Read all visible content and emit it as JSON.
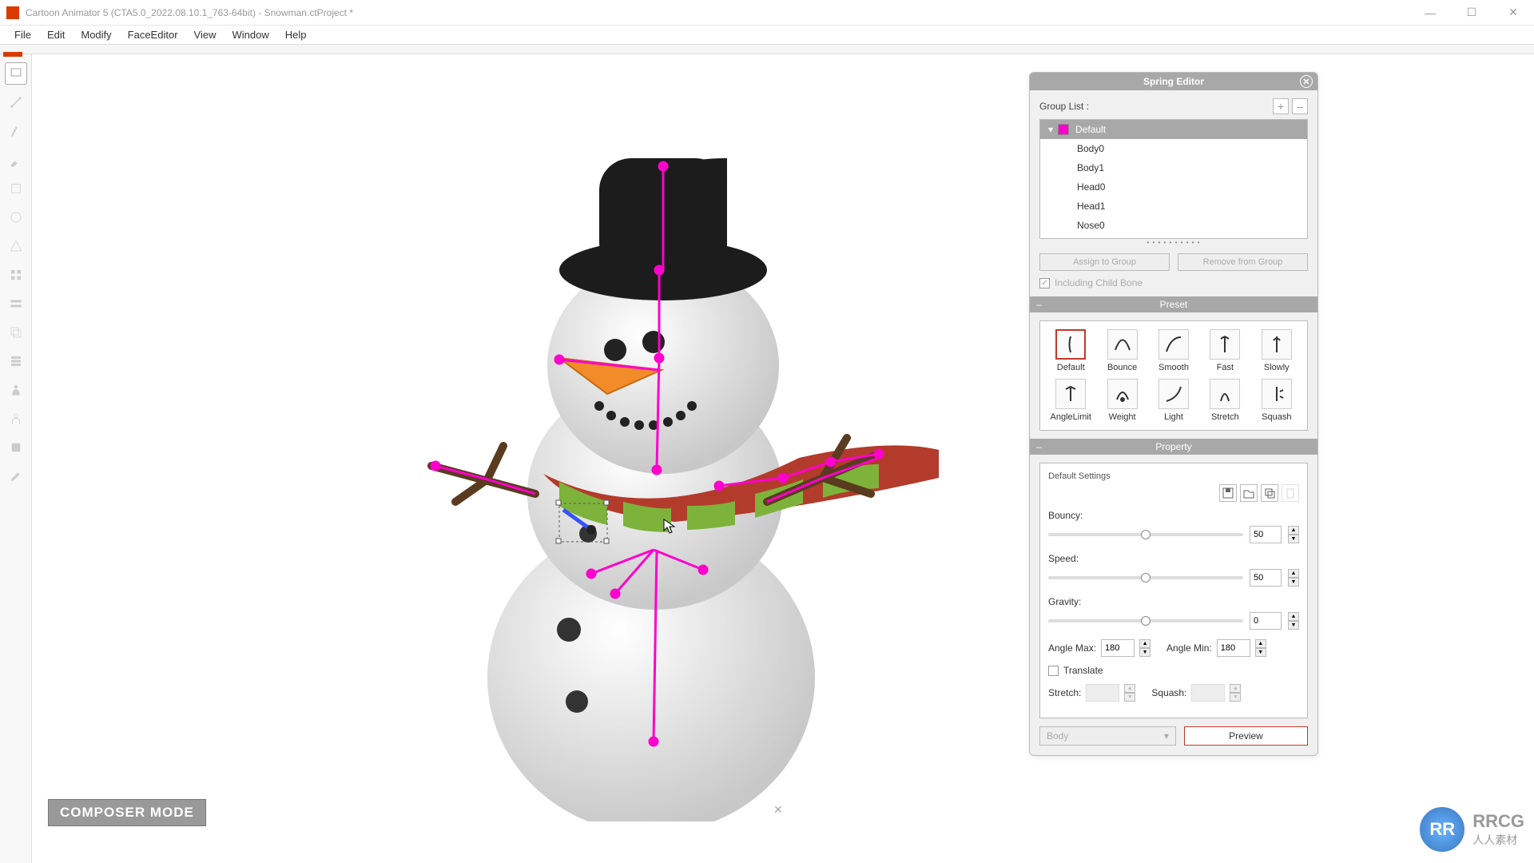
{
  "window": {
    "title": "Cartoon Animator 5 (CTA5.0_2022.08.10.1_763-64bit) - Snowman.ctProject *"
  },
  "menu": {
    "file": "File",
    "edit": "Edit",
    "modify": "Modify",
    "face_editor": "FaceEditor",
    "view": "View",
    "window": "Window",
    "help": "Help"
  },
  "mode_badge": "COMPOSER MODE",
  "spring_editor": {
    "title": "Spring Editor",
    "group_list_label": "Group List :",
    "add": "+",
    "remove": "–",
    "groups": {
      "default": "Default",
      "body0": "Body0",
      "body1": "Body1",
      "head0": "Head0",
      "head1": "Head1",
      "nose0": "Nose0"
    },
    "assign": "Assign to Group",
    "remove_group": "Remove from Group",
    "including_child": "Including Child Bone",
    "preset_head": "Preset",
    "presets": {
      "default": "Default",
      "bounce": "Bounce",
      "smooth": "Smooth",
      "fast": "Fast",
      "slowly": "Slowly",
      "anglelimit": "AngleLimit",
      "weight": "Weight",
      "light": "Light",
      "stretch": "Stretch",
      "squash": "Squash"
    },
    "property_head": "Property",
    "default_settings": "Default Settings",
    "bouncy_label": "Bouncy:",
    "bouncy_value": "50",
    "speed_label": "Speed:",
    "speed_value": "50",
    "gravity_label": "Gravity:",
    "gravity_value": "0",
    "angle_max_label": "Angle Max:",
    "angle_max": "180",
    "angle_min_label": "Angle Min:",
    "angle_min": "180",
    "translate_label": "Translate",
    "stretch_label": "Stretch:",
    "squash_label": "Squash:",
    "body_dropdown": "Body",
    "preview": "Preview"
  },
  "watermark": {
    "logo": "RR",
    "line1": "RRCG",
    "line2": "人人素材"
  },
  "colors": {
    "accent_red": "#c0392b",
    "bone_pink": "#ff00cc"
  }
}
